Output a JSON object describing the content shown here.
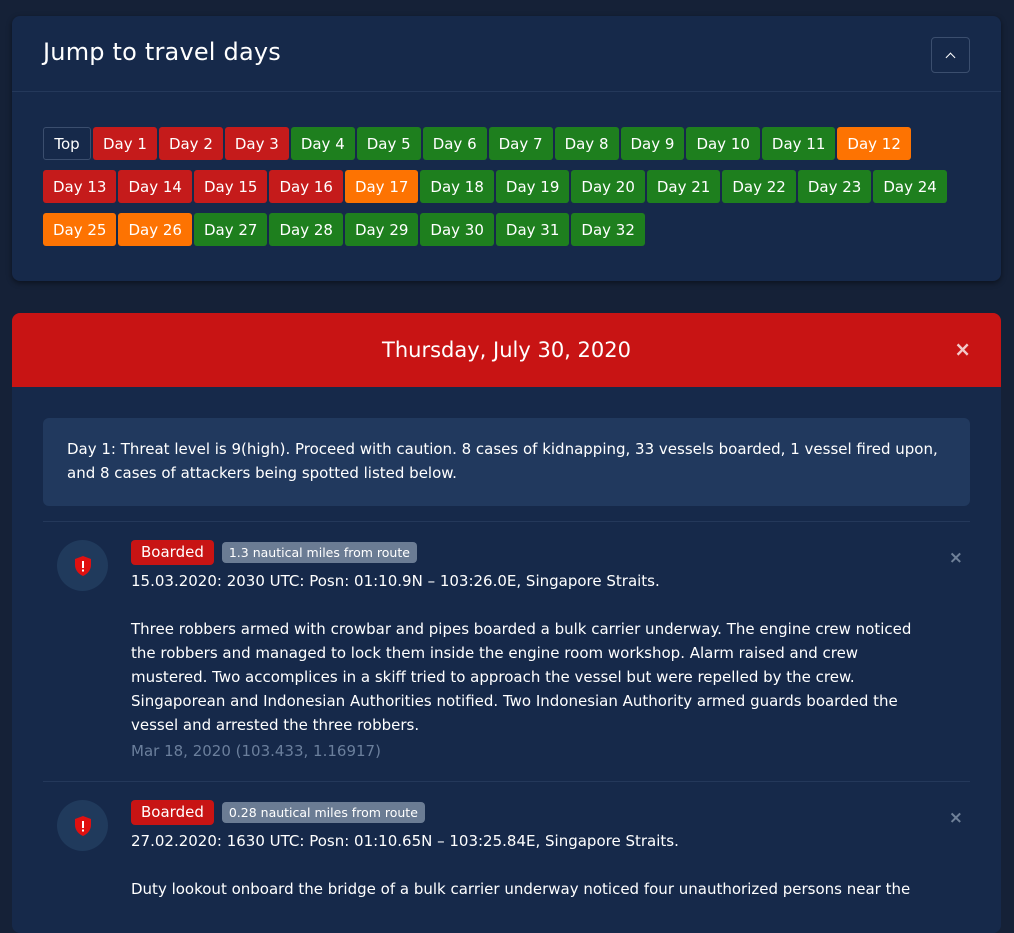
{
  "jump_card": {
    "title": "Jump to travel days",
    "top_label": "Top",
    "days": [
      {
        "label": "Day 1",
        "status": "red"
      },
      {
        "label": "Day 2",
        "status": "red"
      },
      {
        "label": "Day 3",
        "status": "red"
      },
      {
        "label": "Day 4",
        "status": "green"
      },
      {
        "label": "Day 5",
        "status": "green"
      },
      {
        "label": "Day 6",
        "status": "green"
      },
      {
        "label": "Day 7",
        "status": "green"
      },
      {
        "label": "Day 8",
        "status": "green"
      },
      {
        "label": "Day 9",
        "status": "green"
      },
      {
        "label": "Day 10",
        "status": "green"
      },
      {
        "label": "Day 11",
        "status": "green"
      },
      {
        "label": "Day 12",
        "status": "orange"
      },
      {
        "label": "Day 13",
        "status": "red"
      },
      {
        "label": "Day 14",
        "status": "red"
      },
      {
        "label": "Day 15",
        "status": "red"
      },
      {
        "label": "Day 16",
        "status": "red"
      },
      {
        "label": "Day 17",
        "status": "orange"
      },
      {
        "label": "Day 18",
        "status": "green"
      },
      {
        "label": "Day 19",
        "status": "green"
      },
      {
        "label": "Day 20",
        "status": "green"
      },
      {
        "label": "Day 21",
        "status": "green"
      },
      {
        "label": "Day 22",
        "status": "green"
      },
      {
        "label": "Day 23",
        "status": "green"
      },
      {
        "label": "Day 24",
        "status": "green"
      },
      {
        "label": "Day 25",
        "status": "orange"
      },
      {
        "label": "Day 26",
        "status": "orange"
      },
      {
        "label": "Day 27",
        "status": "green"
      },
      {
        "label": "Day 28",
        "status": "green"
      },
      {
        "label": "Day 29",
        "status": "green"
      },
      {
        "label": "Day 30",
        "status": "green"
      },
      {
        "label": "Day 31",
        "status": "green"
      },
      {
        "label": "Day 32",
        "status": "green"
      }
    ]
  },
  "day_card": {
    "title": "Thursday, July 30, 2020",
    "close_symbol": "×",
    "summary": "Day 1: Threat level is 9(high). Proceed with caution. 8 cases of kidnapping, 33 vessels boarded, 1 vessel fired upon, and 8 cases of attackers being spotted listed below.",
    "incidents": [
      {
        "type": "Boarded",
        "distance": "1.3 nautical miles from route",
        "posn": "15.03.2020: 2030 UTC: Posn: 01:10.9N – 103:26.0E, Singapore Straits.",
        "description": "Three robbers armed with crowbar and pipes boarded a bulk carrier underway. The engine crew noticed the robbers and managed to lock them inside the engine room workshop. Alarm raised and crew mustered. Two accomplices in a skiff tried to approach the vessel but were repelled by the crew. Singaporean and Indonesian Authorities notified. Two Indonesian Authority armed guards boarded the vessel and arrested the three robbers.",
        "meta": "Mar 18, 2020 (103.433, 1.16917)",
        "close_symbol": "×"
      },
      {
        "type": "Boarded",
        "distance": "0.28 nautical miles from route",
        "posn": "27.02.2020: 1630 UTC: Posn: 01:10.65N – 103:25.84E, Singapore Straits.",
        "description": "Duty lookout onboard the bridge of a bulk carrier underway noticed four unauthorized persons near the",
        "meta": "",
        "close_symbol": "×"
      }
    ]
  },
  "colors": {
    "red": "#c51b1b",
    "green": "#1e7f1e",
    "orange": "#fd7302",
    "page_bg": "#152137",
    "card_bg": "#16294a"
  },
  "icons": {
    "collapse": "chevron-up-icon",
    "incident": "shield-alert-icon"
  }
}
